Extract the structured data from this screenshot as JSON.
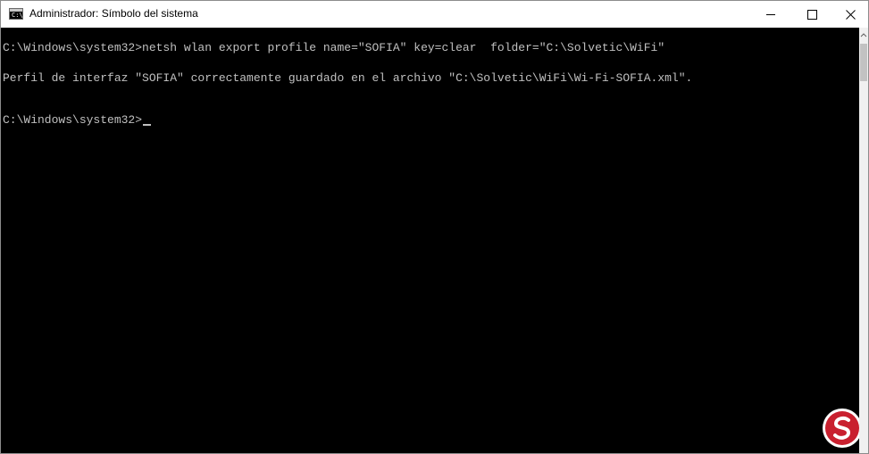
{
  "window": {
    "title": "Administrador: Símbolo del sistema"
  },
  "app_icon": {
    "name": "cmd-icon",
    "glyph": "C:\\"
  },
  "caption_buttons": {
    "minimize": "minimize-icon",
    "maximize": "maximize-icon",
    "close": "close-icon"
  },
  "console": {
    "background": "#000000",
    "foreground": "#c0c0c0",
    "lines": [
      "C:\\Windows\\system32>netsh wlan export profile name=\"SOFIA\" key=clear  folder=\"C:\\Solvetic\\WiFi\"",
      "Perfil de interfaz \"SOFIA\" correctamente guardado en el archivo \"C:\\Solvetic\\WiFi\\Wi-Fi-SOFIA.xml\".",
      "C:\\Windows\\system32>"
    ]
  },
  "watermark": {
    "name": "solvetic-logo-icon"
  }
}
